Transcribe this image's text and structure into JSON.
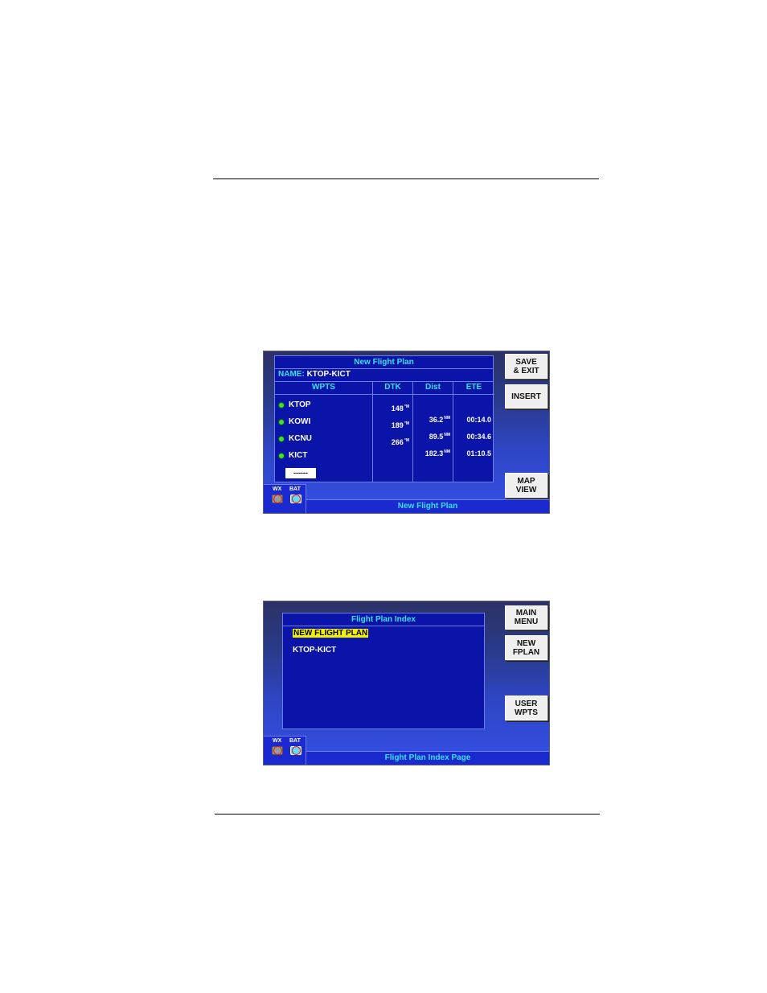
{
  "screen1": {
    "title": "New Flight Plan",
    "name_label": "NAME:",
    "name_value": "KTOP-KICT",
    "columns": [
      "WPTS",
      "DTK",
      "Dist",
      "ETE"
    ],
    "waypoints": [
      "KTOP",
      "KOWI",
      "KCNU",
      "KICT"
    ],
    "dtk": [
      {
        "value": "148",
        "unit": "°M"
      },
      {
        "value": "189",
        "unit": "°M"
      },
      {
        "value": "266",
        "unit": "°M"
      }
    ],
    "dist": [
      {
        "value": "36.2",
        "unit": "NM"
      },
      {
        "value": "89.5",
        "unit": "NM"
      },
      {
        "value": "182.3",
        "unit": "NM"
      }
    ],
    "ete": [
      "00:14.0",
      "00:34.6",
      "01:10.5"
    ],
    "entry_field": "------",
    "buttons": {
      "save_line1": "SAVE",
      "save_line2": "& EXIT",
      "insert": "INSERT",
      "map_line1": "MAP",
      "map_line2": "VIEW"
    },
    "status": {
      "wx": "WX",
      "bat": "BAT"
    },
    "footer": "New Flight Plan"
  },
  "screen2": {
    "title": "Flight Plan Index",
    "items": [
      {
        "label": "NEW FLIGHT PLAN",
        "selected": true
      },
      {
        "label": "KTOP-KICT",
        "selected": false
      }
    ],
    "buttons": {
      "main_line1": "MAIN",
      "main_line2": "MENU",
      "new_line1": "NEW",
      "new_line2": "FPLAN",
      "user_line1": "USER",
      "user_line2": "WPTS"
    },
    "status": {
      "wx": "WX",
      "bat": "BAT"
    },
    "footer": "Flight Plan Index Page"
  },
  "colors": {
    "header_text": "#38e0f0",
    "panel": "#0a14a8",
    "highlight": "#f0f000",
    "waypoint_dot": "#3ee03e"
  }
}
